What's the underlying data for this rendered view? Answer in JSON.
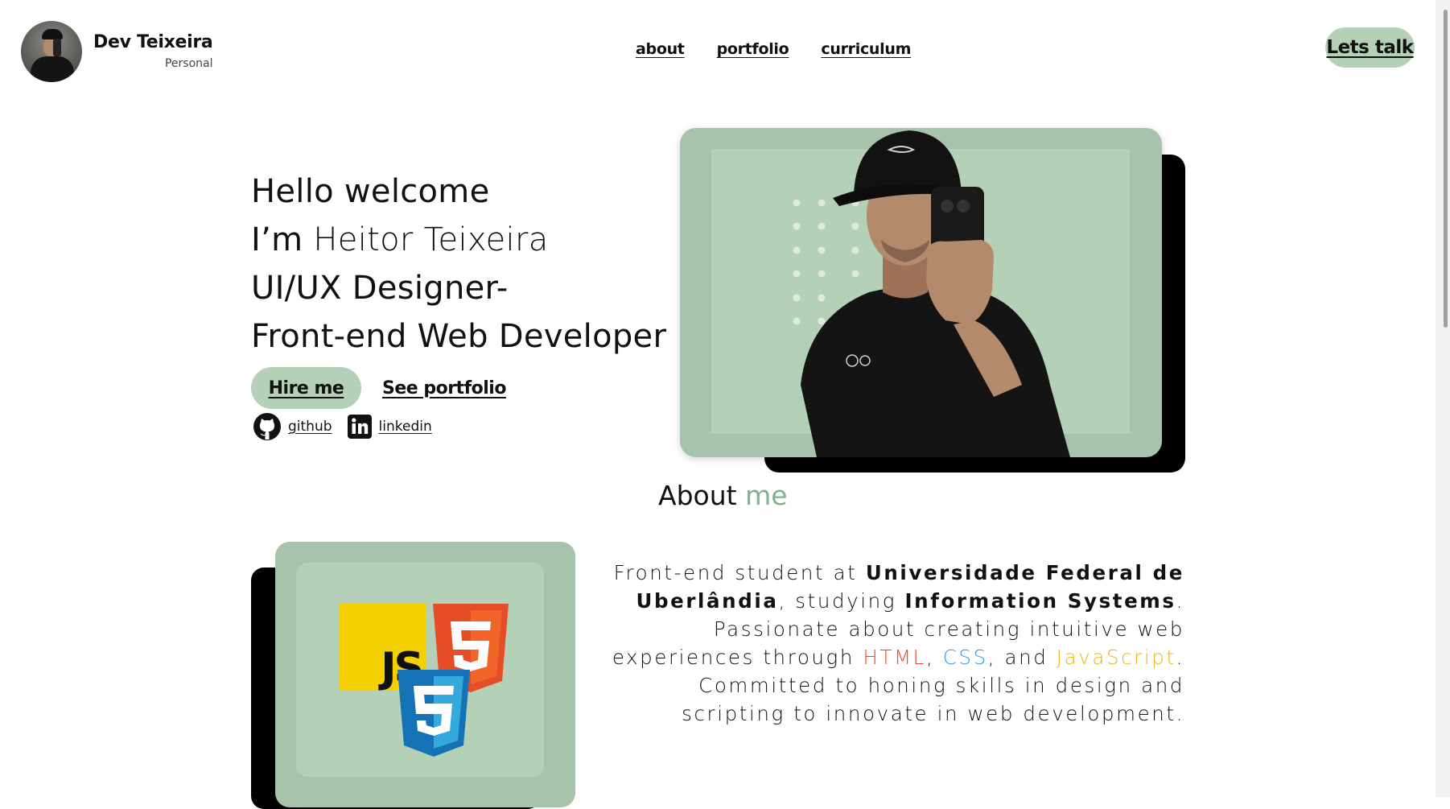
{
  "brand": {
    "name": "Dev Teixeira",
    "subtitle": "Personal"
  },
  "nav": {
    "about": "about",
    "portfolio": "portfolio",
    "curriculum": "curriculum"
  },
  "header": {
    "cta_label": "Lets talk"
  },
  "hero": {
    "line1": "Hello welcome",
    "line2_prefix": "I’m ",
    "line2_name": "Heitor Teixeira",
    "line3": "UI/UX Designer-",
    "line4": "Front-end Web Developer",
    "hire_label": "Hire me",
    "portfolio_label": "See portfolio"
  },
  "socials": {
    "github_label": "github",
    "linkedin_label": "linkedin"
  },
  "about": {
    "title_main": "About ",
    "title_accent": "me",
    "p_1": "Front-end student at ",
    "university": "Universidade Federal de Uberlândia",
    "p_2": ", studying ",
    "course": "Information Systems",
    "p_3": ". Passionate about creating intuitive web experiences through ",
    "html": "HTML",
    "p_4": ", ",
    "css": "CSS",
    "p_5": ", and ",
    "js": "JavaScript",
    "p_6": ". Committed to honing skills in design and scripting to innovate in web development."
  },
  "logos": {
    "js_text": "JS"
  },
  "colors": {
    "accent_green": "#b4d1b8",
    "card_green": "#a8c3ab",
    "title_accent": "#80b28d",
    "html": "#e54c21",
    "css": "#2d9ee0",
    "javascript": "#e8b61c"
  }
}
